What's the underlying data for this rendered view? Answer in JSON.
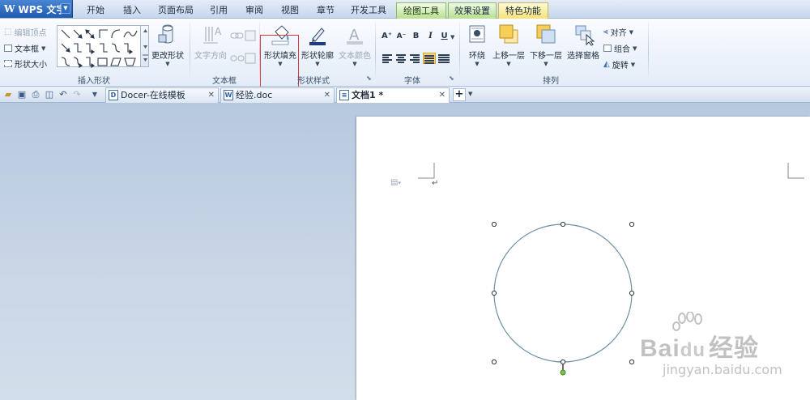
{
  "app": {
    "name": "WPS 文字",
    "logo": "W"
  },
  "menu_tabs": [
    {
      "label": "开始"
    },
    {
      "label": "插入"
    },
    {
      "label": "页面布局"
    },
    {
      "label": "引用"
    },
    {
      "label": "审阅"
    },
    {
      "label": "视图"
    },
    {
      "label": "章节"
    },
    {
      "label": "开发工具"
    },
    {
      "label": "绘图工具"
    },
    {
      "label": "效果设置"
    },
    {
      "label": "特色功能"
    }
  ],
  "ribbon": {
    "insert_shape": {
      "edit_vertices": "编辑顶点",
      "text_box": "文本框",
      "shape_size": "形状大小",
      "change_shape": "更改形状",
      "group_label": "插入形状"
    },
    "textbox": {
      "text_direction": "文字方向",
      "group_label": "文本框"
    },
    "shape_style": {
      "shape_fill": "形状填充",
      "shape_outline": "形状轮廓",
      "text_color": "文本颜色",
      "group_label": "形状样式"
    },
    "font": {
      "group_label": "字体",
      "grow": "A⁺",
      "shrink": "A⁻",
      "bold": "B",
      "italic": "I",
      "underline": "U"
    },
    "arrange": {
      "wrap": "环绕",
      "bring_forward": "上移一层",
      "send_backward": "下移一层",
      "selection_pane": "选择窗格",
      "align": "对齐",
      "group": "组合",
      "rotate": "旋转",
      "group_label": "排列"
    }
  },
  "document_tabs": [
    {
      "label": "Docer-在线模板",
      "icon": "docer-icon",
      "active": false
    },
    {
      "label": "经验.doc",
      "icon": "word-doc-icon",
      "active": false
    },
    {
      "label": "文档1 *",
      "icon": "document-icon",
      "active": true
    }
  ],
  "new_tab_symbol": "+",
  "watermark": {
    "brand": "Bai",
    "brand_du": "du",
    "suffix": "经验",
    "url": "jingyan.baidu.com"
  },
  "colors": {
    "fill_highlight_border": "#e0383f",
    "circle_stroke": "#6e8fa6",
    "rotation_handle": "#7fbf4a",
    "draw_tools_tab": "#b8e08f",
    "special_tab": "#f5e27a"
  }
}
